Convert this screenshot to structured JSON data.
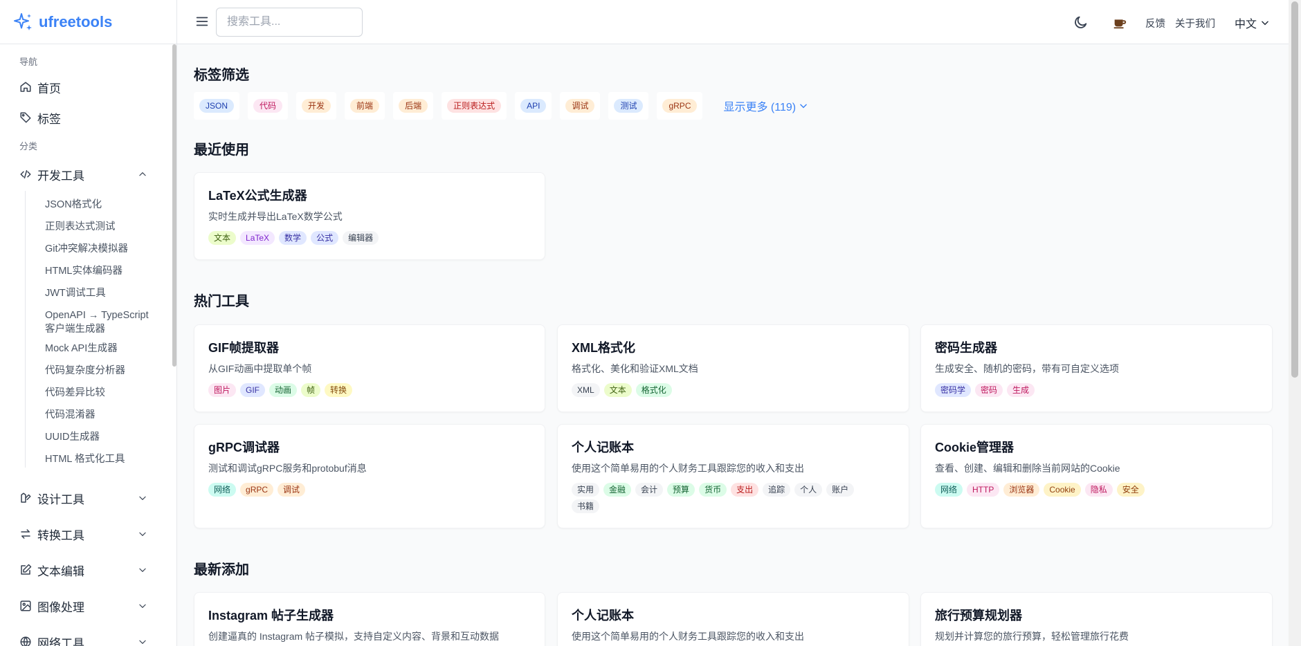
{
  "app": {
    "name": "ufreetools"
  },
  "header": {
    "search_placeholder": "搜索工具...",
    "feedback": "反馈",
    "about": "关于我们",
    "language": "中文",
    "icons": [
      "menu-icon",
      "moon-icon",
      "coffee-icon",
      "chevron-down-icon"
    ]
  },
  "sidebar": {
    "nav_heading": "导航",
    "nav_items": [
      {
        "label": "首页",
        "icon": "home-icon"
      },
      {
        "label": "标签",
        "icon": "tag-icon"
      }
    ],
    "category_heading": "分类",
    "categories": [
      {
        "label": "开发工具",
        "icon": "code-icon",
        "expanded": true
      },
      {
        "label": "设计工具",
        "icon": "design-icon",
        "expanded": false
      },
      {
        "label": "转换工具",
        "icon": "convert-icon",
        "expanded": false
      },
      {
        "label": "文本编辑",
        "icon": "edit-icon",
        "expanded": false
      },
      {
        "label": "图像处理",
        "icon": "image-icon",
        "expanded": false
      },
      {
        "label": "网络工具",
        "icon": "network-icon",
        "expanded": false
      }
    ],
    "dev_tools": [
      "JSON格式化",
      "正则表达式测试",
      "Git冲突解决模拟器",
      "HTML实体编码器",
      "JWT调试工具",
      "OpenAPI → TypeScript 客户端生成器",
      "Mock API生成器",
      "代码复杂度分析器",
      "代码差异比较",
      "代码混淆器",
      "UUID生成器",
      "HTML 格式化工具"
    ]
  },
  "tag_filter": {
    "title": "标签筛选",
    "tags": [
      {
        "label": "JSON",
        "bg": "#dbeafe",
        "fg": "#1e40af"
      },
      {
        "label": "代码",
        "bg": "#fce7f3",
        "fg": "#be185d"
      },
      {
        "label": "开发",
        "bg": "#ffedd5",
        "fg": "#9a3412"
      },
      {
        "label": "前端",
        "bg": "#ffedd5",
        "fg": "#9a3412"
      },
      {
        "label": "后端",
        "bg": "#ffedd5",
        "fg": "#9a3412"
      },
      {
        "label": "正则表达式",
        "bg": "#fee2e2",
        "fg": "#b91c1c"
      },
      {
        "label": "API",
        "bg": "#dbeafe",
        "fg": "#1e40af"
      },
      {
        "label": "调试",
        "bg": "#ffedd5",
        "fg": "#9a3412"
      },
      {
        "label": "测试",
        "bg": "#dbeafe",
        "fg": "#1e40af"
      },
      {
        "label": "gRPC",
        "bg": "#ffedd5",
        "fg": "#9a3412"
      }
    ],
    "show_more": "显示更多 (119)"
  },
  "recent": {
    "title": "最近使用",
    "cards": [
      {
        "title": "LaTeX公式生成器",
        "desc": "实时生成并导出LaTeX数学公式",
        "tags": [
          {
            "label": "文本",
            "bg": "#ecfccb",
            "fg": "#3f6212"
          },
          {
            "label": "LaTeX",
            "bg": "#f3e8ff",
            "fg": "#7e22ce"
          },
          {
            "label": "数学",
            "bg": "#e0e7ff",
            "fg": "#3730a3"
          },
          {
            "label": "公式",
            "bg": "#e0e7ff",
            "fg": "#3730a3"
          },
          {
            "label": "编辑器",
            "bg": "#f3f4f6",
            "fg": "#374151"
          }
        ]
      }
    ]
  },
  "popular": {
    "title": "热门工具",
    "cards": [
      {
        "title": "GIF帧提取器",
        "desc": "从GIF动画中提取单个帧",
        "tags": [
          {
            "label": "图片",
            "bg": "#fce7f3",
            "fg": "#be185d"
          },
          {
            "label": "GIF",
            "bg": "#e0e7ff",
            "fg": "#3730a3"
          },
          {
            "label": "动画",
            "bg": "#dcfce7",
            "fg": "#166534"
          },
          {
            "label": "帧",
            "bg": "#ecfccb",
            "fg": "#3f6212"
          },
          {
            "label": "转换",
            "bg": "#fef9c3",
            "fg": "#854d0e"
          }
        ]
      },
      {
        "title": "XML格式化",
        "desc": "格式化、美化和验证XML文档",
        "tags": [
          {
            "label": "XML",
            "bg": "#f3f4f6",
            "fg": "#374151"
          },
          {
            "label": "文本",
            "bg": "#ecfccb",
            "fg": "#3f6212"
          },
          {
            "label": "格式化",
            "bg": "#dcfce7",
            "fg": "#166534"
          }
        ]
      },
      {
        "title": "密码生成器",
        "desc": "生成安全、随机的密码，带有可自定义选项",
        "tags": [
          {
            "label": "密码学",
            "bg": "#e0e7ff",
            "fg": "#3730a3"
          },
          {
            "label": "密码",
            "bg": "#fce7f3",
            "fg": "#be185d"
          },
          {
            "label": "生成",
            "bg": "#fce7f3",
            "fg": "#be185d"
          }
        ]
      },
      {
        "title": "gRPC调试器",
        "desc": "测试和调试gRPC服务和protobuf消息",
        "tags": [
          {
            "label": "网络",
            "bg": "#ccfbf1",
            "fg": "#115e59"
          },
          {
            "label": "gRPC",
            "bg": "#ffedd5",
            "fg": "#9a3412"
          },
          {
            "label": "调试",
            "bg": "#ffedd5",
            "fg": "#9a3412"
          }
        ]
      },
      {
        "title": "个人记账本",
        "desc": "使用这个简单易用的个人财务工具跟踪您的收入和支出",
        "tags": [
          {
            "label": "实用",
            "bg": "#f3f4f6",
            "fg": "#374151"
          },
          {
            "label": "金融",
            "bg": "#dcfce7",
            "fg": "#166534"
          },
          {
            "label": "会计",
            "bg": "#f3f4f6",
            "fg": "#374151"
          },
          {
            "label": "预算",
            "bg": "#dcfce7",
            "fg": "#166534"
          },
          {
            "label": "货币",
            "bg": "#dcfce7",
            "fg": "#166534"
          },
          {
            "label": "支出",
            "bg": "#fee2e2",
            "fg": "#b91c1c"
          },
          {
            "label": "追踪",
            "bg": "#f3f4f6",
            "fg": "#374151"
          },
          {
            "label": "个人",
            "bg": "#f3f4f6",
            "fg": "#374151"
          },
          {
            "label": "账户",
            "bg": "#f3f4f6",
            "fg": "#374151"
          },
          {
            "label": "书籍",
            "bg": "#f3f4f6",
            "fg": "#374151"
          }
        ]
      },
      {
        "title": "Cookie管理器",
        "desc": "查看、创建、编辑和删除当前网站的Cookie",
        "tags": [
          {
            "label": "网络",
            "bg": "#ccfbf1",
            "fg": "#115e59"
          },
          {
            "label": "HTTP",
            "bg": "#fce7f3",
            "fg": "#be185d"
          },
          {
            "label": "浏览器",
            "bg": "#ffedd5",
            "fg": "#9a3412"
          },
          {
            "label": "Cookie",
            "bg": "#fef3c7",
            "fg": "#92400e"
          },
          {
            "label": "隐私",
            "bg": "#fce7f3",
            "fg": "#be185d"
          },
          {
            "label": "安全",
            "bg": "#fef3c7",
            "fg": "#92400e"
          }
        ]
      }
    ]
  },
  "newest": {
    "title": "最新添加",
    "cards": [
      {
        "title": "Instagram 帖子生成器",
        "desc": "创建逼真的 Instagram 帖子模拟，支持自定义内容、背景和互动数据"
      },
      {
        "title": "个人记账本",
        "desc": "使用这个简单易用的个人财务工具跟踪您的收入和支出"
      },
      {
        "title": "旅行预算规划器",
        "desc": "规划并计算您的旅行预算，轻松管理旅行花费"
      }
    ]
  }
}
